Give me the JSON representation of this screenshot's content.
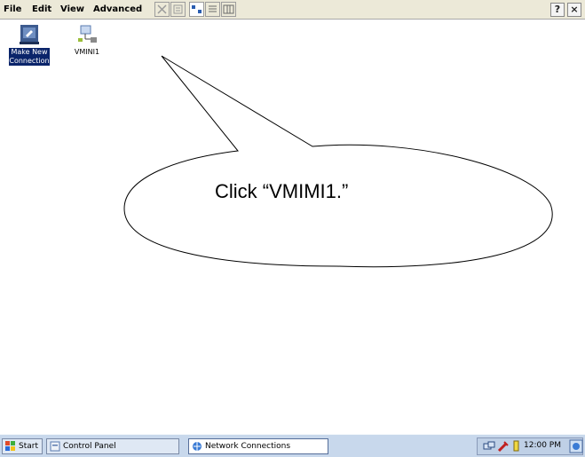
{
  "menu": {
    "items": [
      "File",
      "Edit",
      "View",
      "Advanced"
    ]
  },
  "toolbar": {
    "buttons": [
      "delete-icon",
      "properties-icon",
      "large-icons-view-icon",
      "list-view-icon",
      "details-view-icon"
    ]
  },
  "window_controls": {
    "help_label": "?",
    "close_label": "×"
  },
  "desktop": {
    "icons": [
      {
        "label_line1": "Make New",
        "label_line2": "Connection",
        "icon": "make-new-connection-icon",
        "selected": true
      },
      {
        "label_line1": "VMINI1",
        "label_line2": "",
        "icon": "network-connection-icon",
        "selected": false
      }
    ]
  },
  "callout": {
    "text": "Click “VMIMI1.”"
  },
  "taskbar": {
    "start_label": "Start",
    "tasks": [
      {
        "label": "Control Panel",
        "icon": "control-panel-icon"
      },
      {
        "label": "Network Connections",
        "icon": "network-connections-icon"
      }
    ],
    "clock": "12:00 PM"
  }
}
